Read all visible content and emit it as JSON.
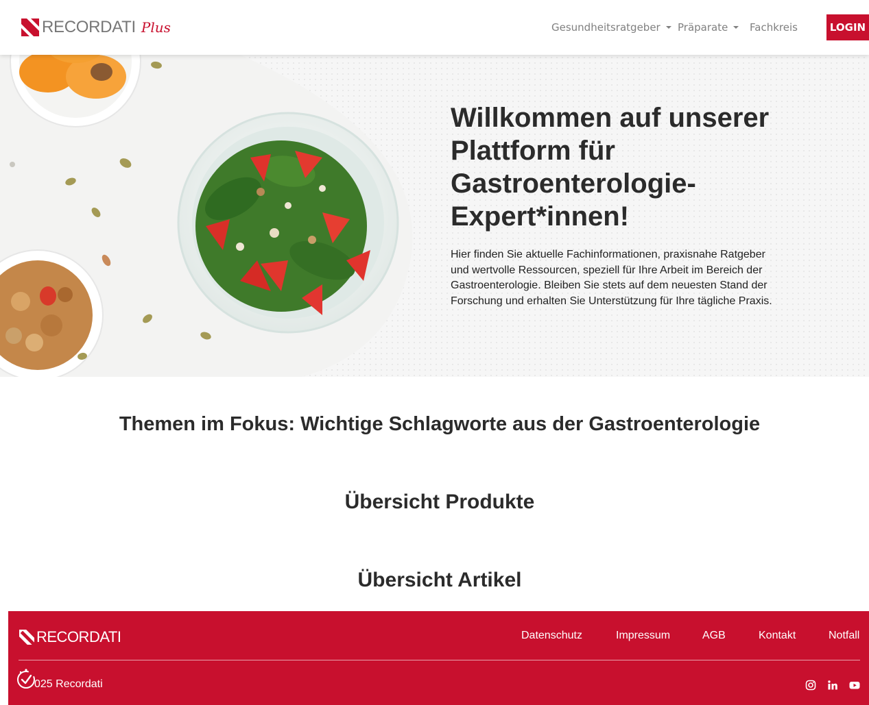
{
  "header": {
    "logo": {
      "brand": "RECORDATI",
      "suffix": "Plus"
    },
    "nav": [
      {
        "label": "Gesundheitsratgeber",
        "dropdown": true
      },
      {
        "label": "Präparate",
        "dropdown": true
      },
      {
        "label": "Fachkreis",
        "dropdown": false
      }
    ],
    "login_label": "LOGIN"
  },
  "hero": {
    "title": "Willkommen auf unserer Plattform für Gastroenterologie-Expert*innen!",
    "body": "Hier finden Sie aktuelle Fachinformationen, praxisnahe Ratgeber und wertvolle Ressourcen, speziell für Ihre Arbeit im Bereich der Gastroenterologie. Bleiben Sie stets auf dem neuesten Stand der Forschung und erhalten Sie Unterstützung für Ihre tägliche Praxis."
  },
  "sections": {
    "themen": "Themen im Fokus: Wichtige Schlagworte aus der Gastroenterologie",
    "produkte": "Übersicht Produkte",
    "artikel": "Übersicht Artikel"
  },
  "footer": {
    "logo": "RECORDATI",
    "links": [
      "Datenschutz",
      "Impressum",
      "AGB",
      "Kontakt",
      "Notfall"
    ],
    "copyright": "025 Recordati",
    "social": [
      "instagram-icon",
      "linkedin-icon",
      "youtube-icon"
    ]
  },
  "colors": {
    "brand_red": "#c8102e",
    "text_dark": "#2b2b2b",
    "nav_gray": "#808080"
  }
}
